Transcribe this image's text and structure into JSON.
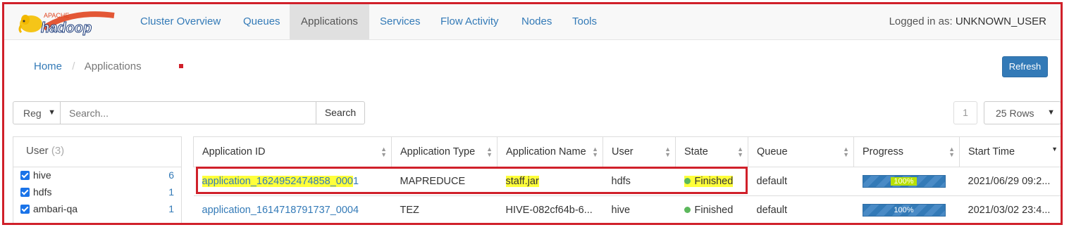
{
  "logo": {
    "top_text": "APACHE",
    "word": "hadoop"
  },
  "nav": {
    "items": [
      "Cluster Overview",
      "Queues",
      "Applications",
      "Services",
      "Flow Activity",
      "Nodes",
      "Tools"
    ],
    "login_label": "Logged in as:",
    "login_user": "UNKNOWN_USER"
  },
  "breadcrumb": {
    "home": "Home",
    "sep": "/",
    "current": "Applications"
  },
  "refresh_label": "Refresh",
  "search": {
    "mode": "Reg",
    "placeholder": "Search...",
    "button": "Search"
  },
  "pagination": {
    "page": "1",
    "rows": "25 Rows"
  },
  "facet": {
    "title": "User",
    "count": "(3)",
    "items": [
      {
        "label": "hive",
        "count": "6"
      },
      {
        "label": "hdfs",
        "count": "1"
      },
      {
        "label": "ambari-qa",
        "count": "1"
      }
    ]
  },
  "table": {
    "headers": [
      "Application ID",
      "Application Type",
      "Application Name",
      "User",
      "State",
      "Queue",
      "Progress",
      "Start Time"
    ],
    "rows": [
      {
        "id": "application_1624952474858_000",
        "id_tail": "1",
        "type": "MAPREDUCE",
        "name": "staff.jar",
        "user": "hdfs",
        "state": "Finished",
        "queue": "default",
        "progress": 100,
        "progress_label": "100%",
        "start": "2021/06/29 09:2..."
      },
      {
        "id": "application_1614718791737_0004",
        "id_tail": "",
        "type": "TEZ",
        "name": "HIVE-082cf64b-6...",
        "user": "hive",
        "state": "Finished",
        "queue": "default",
        "progress": 100,
        "progress_label": "100%",
        "start": "2021/03/02 23:4..."
      }
    ]
  },
  "colors": {
    "accent": "#337ab7",
    "highlight": "#ffff3a",
    "annotation": "#d0202a",
    "success": "#5cb85c"
  }
}
